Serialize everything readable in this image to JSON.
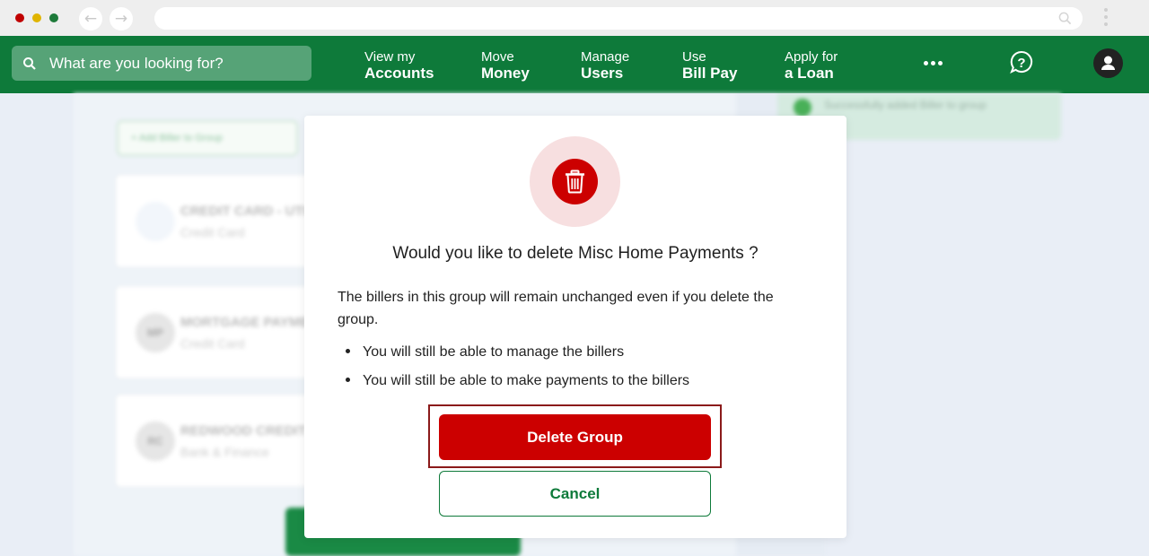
{
  "browser": {
    "dots": [
      "#c00000",
      "#e0b400",
      "#1e7a3a"
    ],
    "back_icon": "arrow-left-icon",
    "forward_icon": "arrow-right-icon",
    "url_icon": "search-icon",
    "menu_icon": "kebab-menu-icon"
  },
  "header": {
    "search_placeholder": "What are you looking for?",
    "nav": [
      {
        "line1": "View my",
        "line2": "Accounts"
      },
      {
        "line1": "Move",
        "line2": "Money"
      },
      {
        "line1": "Manage",
        "line2": "Users"
      },
      {
        "line1": "Use",
        "line2": "Bill Pay"
      },
      {
        "line1": "Apply for",
        "line2": "a Loan"
      }
    ],
    "more_icon": "more-horizontal-icon",
    "help_icon": "help-chat-icon",
    "profile_icon": "user-avatar-icon",
    "brand_color": "#0e7a3a"
  },
  "background": {
    "filter_label": "+ Add Biller to Group",
    "cards": [
      {
        "initials": "",
        "name": "CREDIT CARD - UTI",
        "type": "Credit Card"
      },
      {
        "initials": "MP",
        "name": "MORTGAGE PAYME",
        "type": "Credit Card"
      },
      {
        "initials": "RC",
        "name": "REDWOOD CREDIT",
        "type": "Bank & Finance"
      }
    ],
    "toast_text": "Successfully added Biller to group"
  },
  "modal": {
    "icon": "trash-icon",
    "title": "Would you like to delete Misc Home Payments ?",
    "body": "The billers in this group will remain unchanged even if you delete the group.",
    "bullets": [
      "You will still be able to manage the billers",
      "You will still be able to make payments to the billers"
    ],
    "delete_label": "Delete Group",
    "cancel_label": "Cancel",
    "danger_color": "#cc0000"
  }
}
